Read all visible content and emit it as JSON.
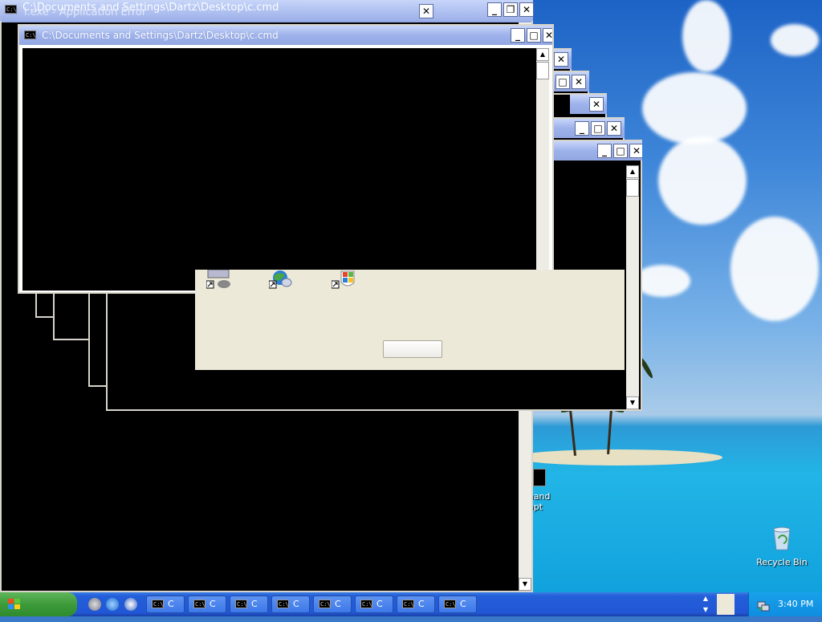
{
  "desktop": {
    "icons": [
      {
        "label": "Recycle Bin"
      }
    ],
    "partial_icon_text": [
      "mand",
      "mpt"
    ]
  },
  "windows": {
    "back_window": {
      "title": "C:\\Documents and Settings\\Dartz\\Desktop\\c.cmd",
      "error_title": "i.exe - Application Error"
    },
    "main_window": {
      "title": "C:\\Documents and Settings\\Dartz\\Desktop\\c.cmd",
      "icon_text": "C:\\"
    }
  },
  "dialog_fragment": {
    "button_label": ""
  },
  "taskbar": {
    "start_label": "",
    "task_buttons": [
      {
        "icon_text": "C:\\",
        "label": "C"
      },
      {
        "icon_text": "C:\\",
        "label": "C"
      },
      {
        "icon_text": "C:\\",
        "label": "C"
      },
      {
        "icon_text": "C:\\",
        "label": "C"
      },
      {
        "icon_text": "C:\\",
        "label": "C"
      },
      {
        "icon_text": "C:\\",
        "label": "C"
      },
      {
        "icon_text": "C:\\",
        "label": "C"
      },
      {
        "icon_text": "C:\\",
        "label": "C"
      }
    ],
    "clock": "3:40 PM"
  },
  "colors": {
    "titlebar_inactive": "#9db1ea",
    "console_bg": "#000000",
    "taskbar_blue": "#2157d6",
    "start_green": "#3e9b3a",
    "tray_blue": "#0f8de0"
  }
}
